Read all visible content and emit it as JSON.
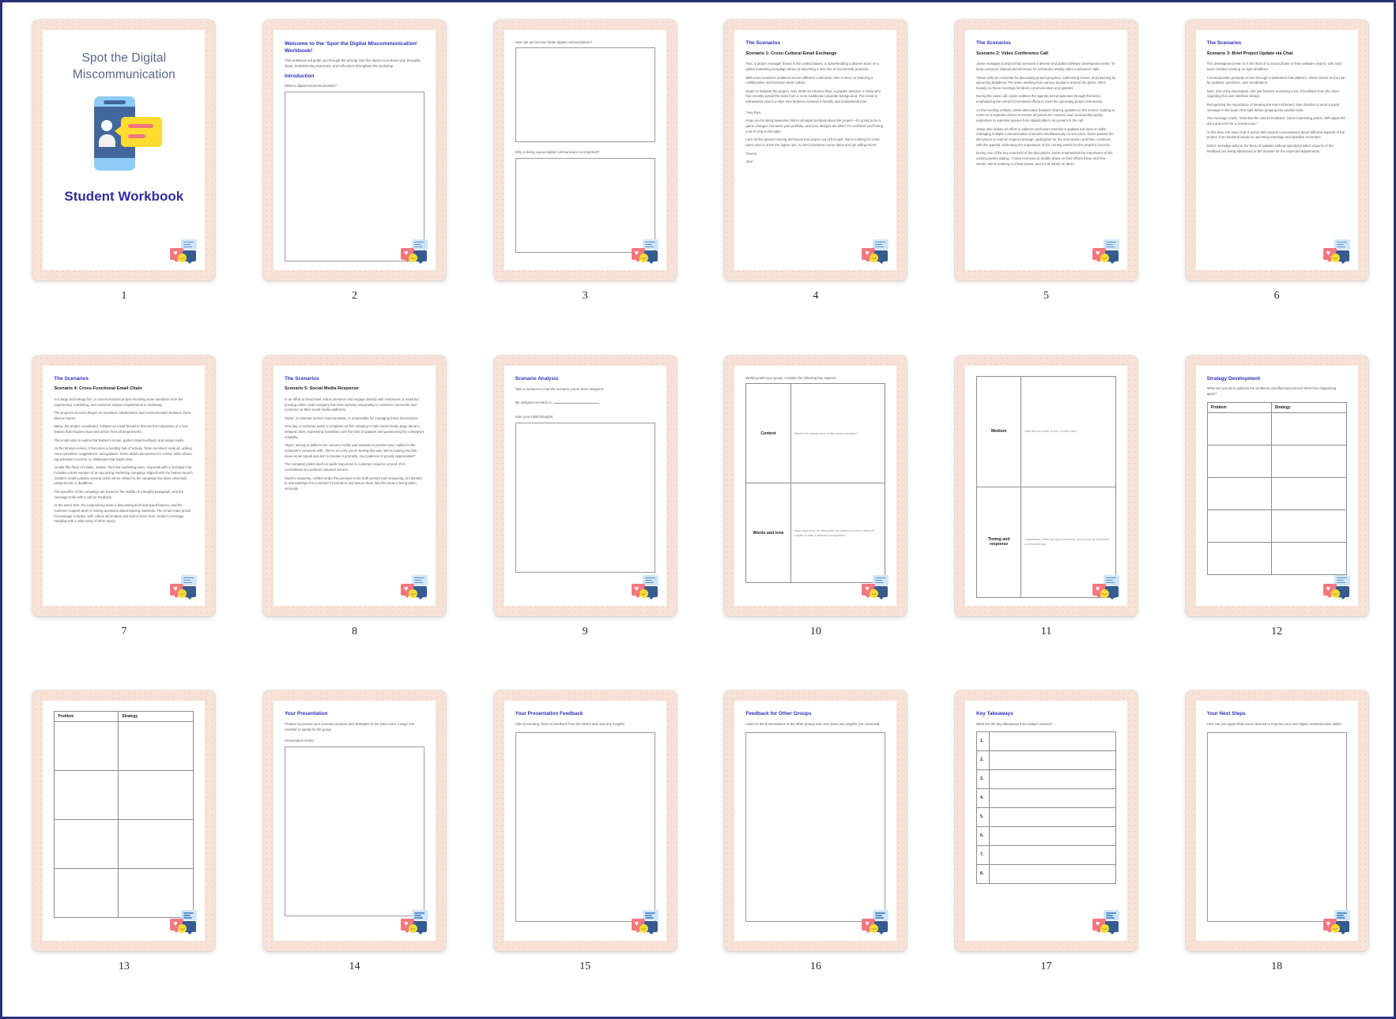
{
  "document": {
    "title": "Spot the Digital Miscommunication",
    "subtitle": "Student Workbook",
    "logo_name": "chat-bubbles-logo"
  },
  "pages": [
    {
      "number": "1",
      "kind": "cover",
      "title": "Spot the Digital Miscommunication",
      "subtitle": "Student Workbook"
    },
    {
      "number": "2",
      "kind": "intro",
      "heading": "Welcome to the 'Spot the Digital Miscommunication' Workbook!",
      "intro": "This workbook will guide you through the activity. Use this space to jot down your thoughts, ideas, brainstorming outcomes, and reflections throughout the workshop.",
      "section": "Introduction",
      "question": "What is digital miscommunication?"
    },
    {
      "number": "3",
      "kind": "two-questions",
      "question1": "How can we become better digital communicators?",
      "question2": "Why is being a good digital communicator so important?"
    },
    {
      "number": "4",
      "kind": "scenario",
      "heading": "The Scenarios",
      "subheading": "Scenario 1: Cross-Cultural Email Exchange",
      "paragraphs": [
        "Alex, a project manager based in the United States, is spearheading a diverse team on a global marketing campaign aimed at launching a new line of eco-friendly products.",
        "With team members scattered across different continents, Alex is keen on fostering a collaborative and inclusive team culture.",
        "Eager to kickstart the project, Alex drafts an email to Ravi, a graphic designer in India who has recently joined the team from a more traditional corporate background. The email is enthusiastic and in a style Alex believes conveys a friendly and motivational tone.",
        "\"Hey Ravi,",
        "Hope you're doing awesome! We're all super pumped about the project—it's going to be a game-changer. I've seen your portfolio, and your designs are killer! I'm confident you'll bring a lot of zing to the table.",
        "Let's hit the ground running and knock this project out of the park. We're looking for some quick wins to show the higher ups, so let's brainstorm some ideas and get rolling ASAP.",
        "Cheers,",
        "Alex\""
      ]
    },
    {
      "number": "5",
      "kind": "scenario",
      "heading": "The Scenarios",
      "subheading": "Scenario 2: Video Conference Call",
      "paragraphs": [
        "Jamie manages a project that oversees a diverse and global software development team. To keep everyone aligned and informed, he schedules weekly video conference calls.",
        "These calls are essential for discussing project progress, addressing issues, and planning for upcoming deadlines.The team, working from various locations around the globe, relies heavily on these meetings for direct communication and updates.",
        "During the video call, Jamie outlines the agenda and progresses through the items, emphasizing the need for increased efforts to meet the upcoming project milestones.",
        "As the meeting unfolds, Jamie alternates between sharing updates on the screen, looking at notes on a separate device to ensure all points are covered, and occasionally typing responses to real-time queries from stakeholders not present in the call.",
        "Jamie also makes an effort to address each team member's updates but does so while managing multiple communication channels simultaneously. At one point, Jamie pauses the discussion to read an urgent message, apologizes for the interruption, and then continues with the agenda, reiterating the importance of the coming weeks for the project's success.",
        "During one of the key moments of the discussion, Jamie emphasized the importance of the coming weeks stating, \"I need everyone to double down on their efforts these next few weeks. We're entering a critical phase, and it's all hands on deck.\""
      ]
    },
    {
      "number": "6",
      "kind": "scenario",
      "heading": "The Scenarios",
      "subheading": "Scenario 3: Brief Project Update via Chat",
      "paragraphs": [
        "The development team is in the thick of a crucial phase in their software project, with each team member working on tight deadlines.",
        "Communication primarily occurs through a dedicated chat platform, which serves as the hub for updates, questions, and coordination.",
        "Sam, one of the developers, has just finished reviewing a set of feedback from the client regarding the user interface design.",
        "Recognizing the importance of keeping the team informed, Sam decides to send a quick message in the team chat right before jumping into another task.",
        "The message reads: \"Checked the client's feedback. Some interesting points. Will adjust the docs and send for a review soon.\"",
        "At this time, the team chat is active with various conversations about different aspects of the project, from backend issues to upcoming meetings and deadline reminders.",
        "Sam's message adds to the flurry of updates without specifying which aspects of the feedback are being addressed or the timeline for the expected adjustments."
      ]
    },
    {
      "number": "7",
      "kind": "scenario",
      "heading": "The Scenarios",
      "subheading": "Scenario 4: Cross-Functional Email Chain",
      "paragraphs": [
        "In a large technology firm, a cross-functional project involving team members from the engineering, marketing, and customer support departments is underway.",
        "The project's success hinges on seamless collaboration and communication between these diverse teams.",
        "Maria, the project coordinator, initiates an email thread to discuss the integration of a new feature that requires input and action from all departments.",
        "The email aims to outline the feature's scope, gather initial feedback, and assign tasks.",
        "As the thread evolves, it becomes a bustling hub of activity. Team members reply all, adding more questions, suggestions, and updates. Some attach documents for review, while others tag potential concerns or challenges that might arise.",
        "Amidst this flurry of emails, Jordan, from the marketing team, responds with a message that includes a brief mention of an upcoming marketing campaign aligned with the feature launch. Jordan's email contains several action items related to the campaign but lacks clear task assignments or deadlines.",
        "The specifics of the campaign are buried in the middle of a lengthy paragraph, and the message ends with a call for feedback.",
        "At the same time, the engineering team is discussing technical specifications, and the customer support team is raising questions about training materials. The email chain grows increasingly complex, with critical information and action items from Jordan's message mingling with a wide array of other topics."
      ]
    },
    {
      "number": "8",
      "kind": "scenario",
      "heading": "The Scenarios",
      "subheading": "Scenario 5: Social Media Response",
      "paragraphs": [
        "In an effort to boost their online presence and engage directly with customers, a small but growing online retail company has been actively responding to customer comments and concerns on their social media platforms.",
        "Taylor, a customer service representative, is responsible for managing these interactions.",
        "One day, a customer posts a complaint on the company's main social media page about a delayed order, expressing frustration over the lack of updates and questioning the company's reliability.",
        "Taylor, aiming to address the concern swiftly and maintain a positive tone, replies to the customer's comment with, \"We're so sorry you're feeling this way. We're looking into this issue as we speak and aim to resolve it promptly. Your patience is greatly appreciated!\"",
        "The company prides itself on quick responses to customer inquiries as part of its commitment to excellent customer service.",
        "Taylor's response, crafted under the pressure to be both prompt and reassuring, is intended to acknowledge the customer's frustration and assure them that the issue is being taken seriously."
      ]
    },
    {
      "number": "9",
      "kind": "analysis",
      "heading": "Scenario Analysis",
      "intro": "Take a moment to read the scenario you've been assigned.",
      "assigned_label": "My assigned scenario is:",
      "notes_label": "Note your initial thoughts:"
    },
    {
      "number": "10",
      "kind": "matrix-a",
      "intro": "Working with your group, consider the following key aspects:",
      "rows": [
        {
          "label": "Context",
          "prompt": "What's the background of this communication?"
        },
        {
          "label": "Words and tone",
          "prompt": "How might they be interpreted by someone from a different culture or with a different perspective?"
        }
      ]
    },
    {
      "number": "11",
      "kind": "matrix-b",
      "rows": [
        {
          "label": "Medium",
          "prompt": "Was this an email, a text, a video call?"
        },
        {
          "label": "Timing and response",
          "prompt": "Sometimes, when we say something, can be just as important as what we say."
        }
      ]
    },
    {
      "number": "12",
      "kind": "strategy",
      "heading": "Strategy Development",
      "intro": "What can you do to address the problems identified and prevent them from happening again?",
      "columns": [
        "Problem",
        "Strategy"
      ],
      "row_count": 5
    },
    {
      "number": "13",
      "kind": "strategy-table-only",
      "columns": [
        "Problem",
        "Strategy"
      ],
      "row_count": 4
    },
    {
      "number": "14",
      "kind": "presentation",
      "heading": "Your Presentation",
      "intro": "Prepare to present your scenario analysis and strategies to the main room. Assign one member to speak for the group.",
      "notes_label": "Presentation Notes:"
    },
    {
      "number": "15",
      "kind": "single-question",
      "heading": "Your Presentation Feedback",
      "intro": "After presenting, listen to feedback from the others and note any insights."
    },
    {
      "number": "16",
      "kind": "single-question",
      "heading": "Feedback for Other Groups",
      "intro": "Listen to the presentations of the other groups and note down any insights you could add."
    },
    {
      "number": "17",
      "kind": "takeaways",
      "heading": "Key Takeaways",
      "intro": "What are the key takeaways from today's session?",
      "numbers": [
        "1.",
        "2.",
        "3.",
        "4.",
        "5.",
        "6.",
        "7.",
        "8."
      ]
    },
    {
      "number": "18",
      "kind": "next-steps",
      "heading": "Your Next Steps",
      "intro": "How can you apply what you've learned to improve your own digital communication skills?"
    }
  ],
  "colors": {
    "frame": "#f7e2d7",
    "heading_blue": "#2b31b8",
    "cover_title": "#5a6790",
    "cover_sub": "#2f2f9e",
    "body_text": "#5d5d63",
    "border": "#2b2f77"
  }
}
